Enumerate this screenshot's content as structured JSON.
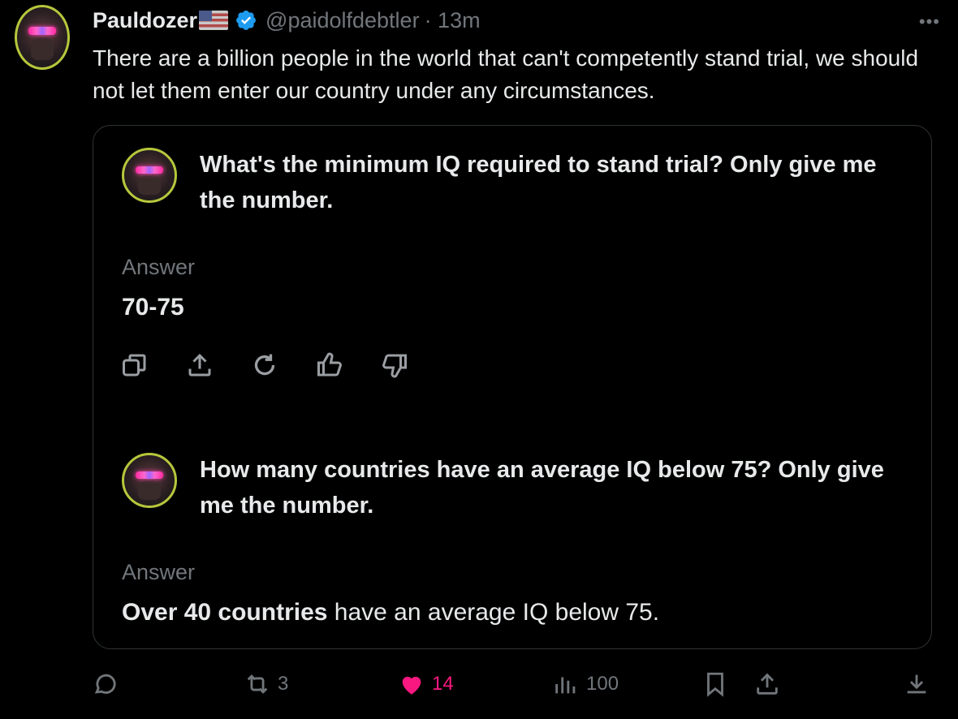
{
  "author": {
    "name": "Pauldozer",
    "handle": "@paidolfdebtler",
    "time": "· 13m"
  },
  "more_label": "•••",
  "tweet": {
    "text": "There are a billion people in the world that can't competently stand trial, we should not let them enter our country under any circumstances."
  },
  "card": {
    "q1": {
      "question": "What's the minimum IQ required to stand trial? Only give me the number.",
      "answer_label": "Answer",
      "answer": "70-75"
    },
    "q2": {
      "question": "How many countries have an average IQ below 75? Only give me the number.",
      "answer_label": "Answer",
      "answer_bold": "Over 40 countries",
      "answer_rest": " have an average IQ below 75."
    }
  },
  "actions": {
    "retweets": "3",
    "likes": "14",
    "views": "100"
  },
  "colors": {
    "background": "#000000",
    "text": "#e7e9ea",
    "muted": "#71767b",
    "like": "#f91880",
    "verified": "#1d9bf0"
  }
}
